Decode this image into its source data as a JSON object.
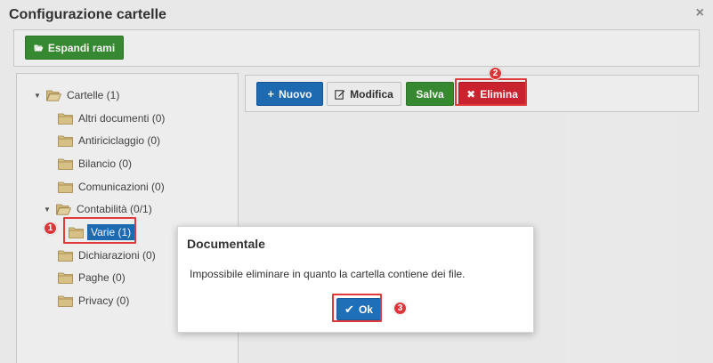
{
  "dialog": {
    "title": "Configurazione cartelle",
    "close_symbol": "×"
  },
  "toolbar": {
    "expand_label": "Espandi rami"
  },
  "actions": {
    "new_label": "Nuovo",
    "edit_label": "Modifica",
    "save_label": "Salva",
    "delete_label": "Elimina"
  },
  "tree": {
    "root": "Cartelle (1)",
    "items": {
      "altri": "Altri documenti (0)",
      "antiriciclaggio": "Antiriciclaggio (0)",
      "bilancio": "Bilancio (0)",
      "comunicazioni": "Comunicazioni (0)",
      "contabilita": "Contabilità (0/1)",
      "varie": "Varie (1)",
      "dichiarazioni": "Dichiarazioni (0)",
      "paghe": "Paghe (0)",
      "privacy": "Privacy (0)"
    }
  },
  "callouts": {
    "one": "1",
    "two": "2",
    "three": "3"
  },
  "modal": {
    "title": "Documentale",
    "message": "Impossibile eliminare in quanto la cartella contiene dei file.",
    "ok_label": "Ok"
  },
  "colors": {
    "primary_blue": "#1f6fb8",
    "success_green": "#3a8f34",
    "danger_red": "#d12530",
    "highlight_red": "#e03a3a",
    "folder_tan": "#e0c88c"
  },
  "icons": {
    "expand": "folder-open-icon",
    "new": "plus-icon",
    "edit": "edit-icon",
    "delete": "times-icon",
    "ok": "check-icon",
    "folder": "folder-icon",
    "folder_open": "folder-open-icon",
    "caret": "caret-down-icon"
  }
}
